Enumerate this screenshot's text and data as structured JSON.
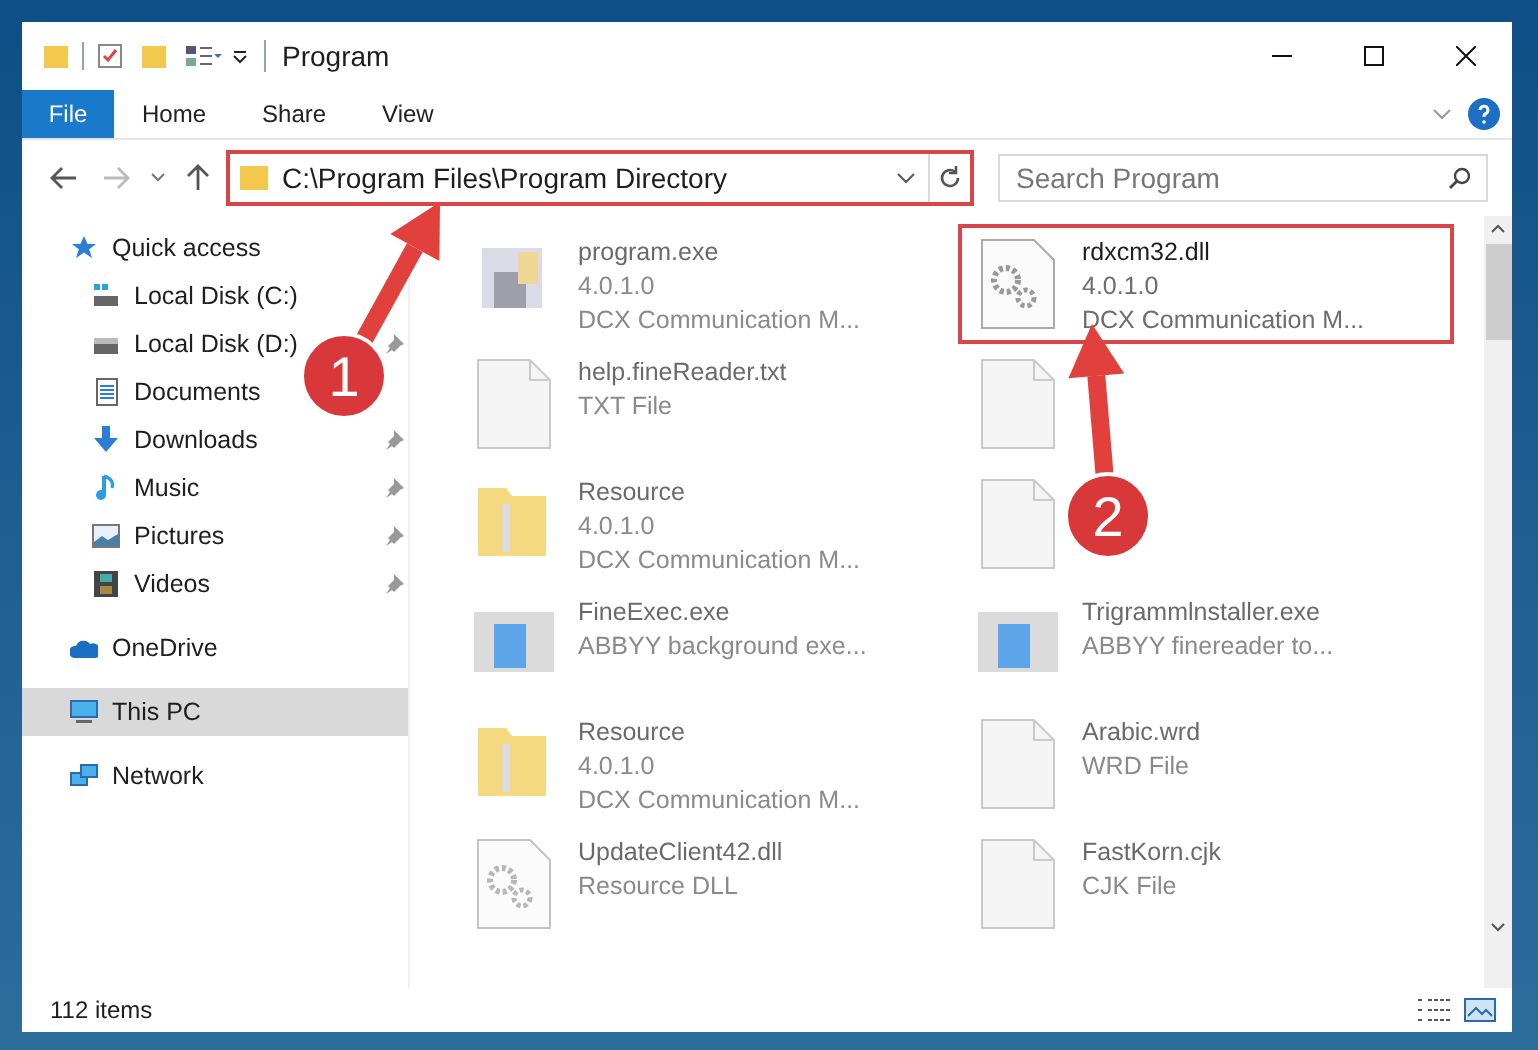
{
  "window": {
    "title": "Program"
  },
  "ribbon_tabs": [
    {
      "label": "File",
      "kind": "file"
    },
    {
      "label": "Home",
      "kind": "tab"
    },
    {
      "label": "Share",
      "kind": "tab"
    },
    {
      "label": "View",
      "kind": "tab"
    }
  ],
  "address_bar": {
    "path": "C:\\Program Files\\Program Directory",
    "highlighted": true
  },
  "search": {
    "placeholder": "Search Program"
  },
  "sidebar": {
    "items": [
      {
        "label": "Quick access",
        "pinned": false,
        "selected": false,
        "children": [
          {
            "label": "Local Disk (C:)",
            "pinned": false,
            "selected": false
          },
          {
            "label": "Local Disk (D:)",
            "pinned": true,
            "selected": false
          },
          {
            "label": "Documents",
            "pinned": false,
            "selected": false
          },
          {
            "label": "Downloads",
            "pinned": true,
            "selected": false
          },
          {
            "label": "Music",
            "pinned": true,
            "selected": false
          },
          {
            "label": "Pictures",
            "pinned": true,
            "selected": false
          },
          {
            "label": "Videos",
            "pinned": true,
            "selected": false
          }
        ]
      },
      {
        "label": "OneDrive",
        "pinned": false,
        "selected": false
      },
      {
        "label": "This PC",
        "pinned": false,
        "selected": true
      },
      {
        "label": "Network",
        "pinned": false,
        "selected": false
      }
    ]
  },
  "files": [
    {
      "kind": "exe",
      "lines": [
        "program.exe",
        "4.0.1.0",
        "DCX Communication M..."
      ],
      "highlighted": false
    },
    {
      "kind": "dll",
      "lines": [
        "rdxcm32.dll",
        "4.0.1.0",
        "DCX Communication M..."
      ],
      "highlighted": true
    },
    {
      "kind": "file",
      "lines": [
        "help.fineReader.txt",
        "TXT File"
      ],
      "highlighted": false
    },
    {
      "kind": "file",
      "highlighted": false
    },
    {
      "kind": "folder",
      "lines": [
        "Resource",
        "4.0.1.0",
        "DCX Communication M..."
      ],
      "highlighted": false
    },
    {
      "kind": "file",
      "highlighted": false
    },
    {
      "kind": "app",
      "lines": [
        "FineExec.exe",
        "ABBYY background exe..."
      ],
      "highlighted": false
    },
    {
      "kind": "app",
      "lines": [
        "Trigrammlnstaller.exe",
        "ABBYY finereader to..."
      ],
      "highlighted": false
    },
    {
      "kind": "folder",
      "lines": [
        "Resource",
        "4.0.1.0",
        "DCX Communication M..."
      ],
      "highlighted": false
    },
    {
      "kind": "file",
      "lines": [
        "Arabic.wrd",
        "WRD File"
      ],
      "highlighted": false
    },
    {
      "kind": "dll",
      "lines": [
        "UpdateClient42.dll",
        "Resource DLL"
      ],
      "highlighted": false
    },
    {
      "kind": "file",
      "lines": [
        "FastKorn.cjk",
        "CJK File"
      ],
      "highlighted": false
    }
  ],
  "status_bar": {
    "count": "112 items"
  },
  "annotations": [
    {
      "label": "1"
    },
    {
      "label": "2"
    }
  ]
}
